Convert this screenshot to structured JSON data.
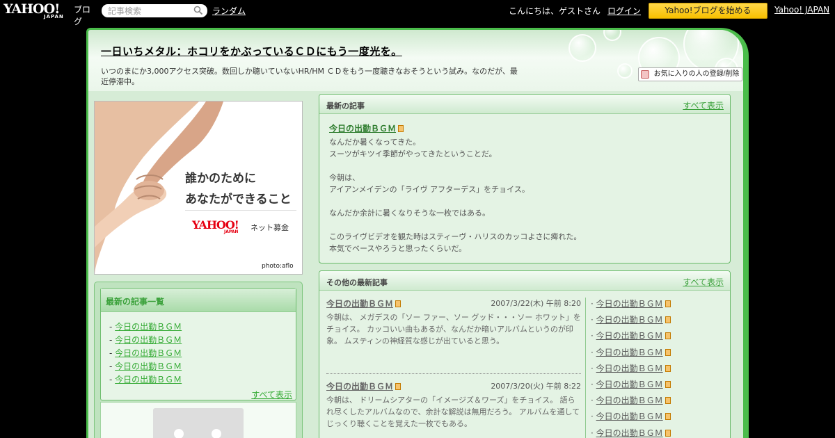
{
  "topbar": {
    "logo_main": "YAHOO!",
    "logo_sub": "JAPAN",
    "logo_service": "ブログ",
    "search_placeholder": "記事検索",
    "random_label": "ランダム",
    "greeting": "こんにちは、ゲストさん",
    "login_label": "ログイン",
    "start_button": "Yahoo!ブログを始める",
    "yahoo_japan_link": "Yahoo! JAPAN"
  },
  "header": {
    "title": "一日いちメタル：ホコリをかぶっているＣＤにもう一度光を。",
    "description": "いつのまにか3,000アクセス突破。数回しか聴いていないHR/HM ＣＤをもう一度聴きなおそうという試み。なのだが、最近停滞中。",
    "favorite_button": "お気に入りの人の登録/削除"
  },
  "ad": {
    "line1": "誰かのために",
    "line2": "あなたができること",
    "logo": "YAHOO!",
    "logo_sub": "JAPAN",
    "brand": "ネット募金",
    "credit": "photo:aflo"
  },
  "sidebar": {
    "title": "最新の記事一覧",
    "items": [
      "今日の出勤ＢＧＭ",
      "今日の出勤ＢＧＭ",
      "今日の出勤ＢＧＭ",
      "今日の出勤ＢＧＭ",
      "今日の出勤ＢＧＭ"
    ],
    "see_all": "すべて表示"
  },
  "latest": {
    "heading": "最新の記事",
    "see_all": "すべて表示",
    "article_title": "今日の出勤ＢＧＭ",
    "body_lines": [
      "なんだか暑くなってきた。",
      "スーツがキツイ季節がやってきたということだ。",
      "",
      "今朝は、",
      "アイアンメイデンの「ライヴ アフターデス」をチョイス。",
      "",
      "なんだか余計に暑くなりそうな一枚ではある。",
      "",
      "このライヴビデオを観た時はスティーヴ・ハリスのカッコよさに痺れた。",
      "本気でベースやろうと思ったくらいだ。"
    ]
  },
  "others": {
    "heading": "その他の最新記事",
    "see_all": "すべて表示",
    "entries": [
      {
        "title": "今日の出勤ＢＧＭ",
        "date": "2007/3/22(木) 午前 8:20",
        "text": "今朝は、 メガデスの「ソー ファー、ソー グッド・・・ソー ホワット」をチョイス。 カッコいい曲もあるが、なんだか暗いアルバムというのが印象。 ムスティンの神経質な感じが出ていると思う。"
      },
      {
        "title": "今日の出勤ＢＧＭ",
        "date": "2007/3/20(火) 午前 8:22",
        "text": "今朝は、 ドリームシアターの「イメージズ＆ワーズ」をチョイス。 語られ尽くしたアルバムなので、余計な解説は無用だろう。 アルバムを通してじっくり聴くことを覚えた一枚でもある。"
      }
    ],
    "side_links": [
      "今日の出勤ＢＧＭ",
      "今日の出勤ＢＧＭ",
      "今日の出勤ＢＧＭ",
      "今日の出勤ＢＧＭ",
      "今日の出勤ＢＧＭ",
      "今日の出勤ＢＧＭ",
      "今日の出勤ＢＧＭ",
      "今日の出勤ＢＧＭ",
      "今日の出勤ＢＧＭ"
    ]
  },
  "colors": {
    "frame_border": "#4bbd4b",
    "accent_green": "#3aa13a",
    "start_button": "#f7c000"
  },
  "icons": {
    "search": "search-icon",
    "article": "document-icon",
    "favorite": "favorite-icon"
  }
}
